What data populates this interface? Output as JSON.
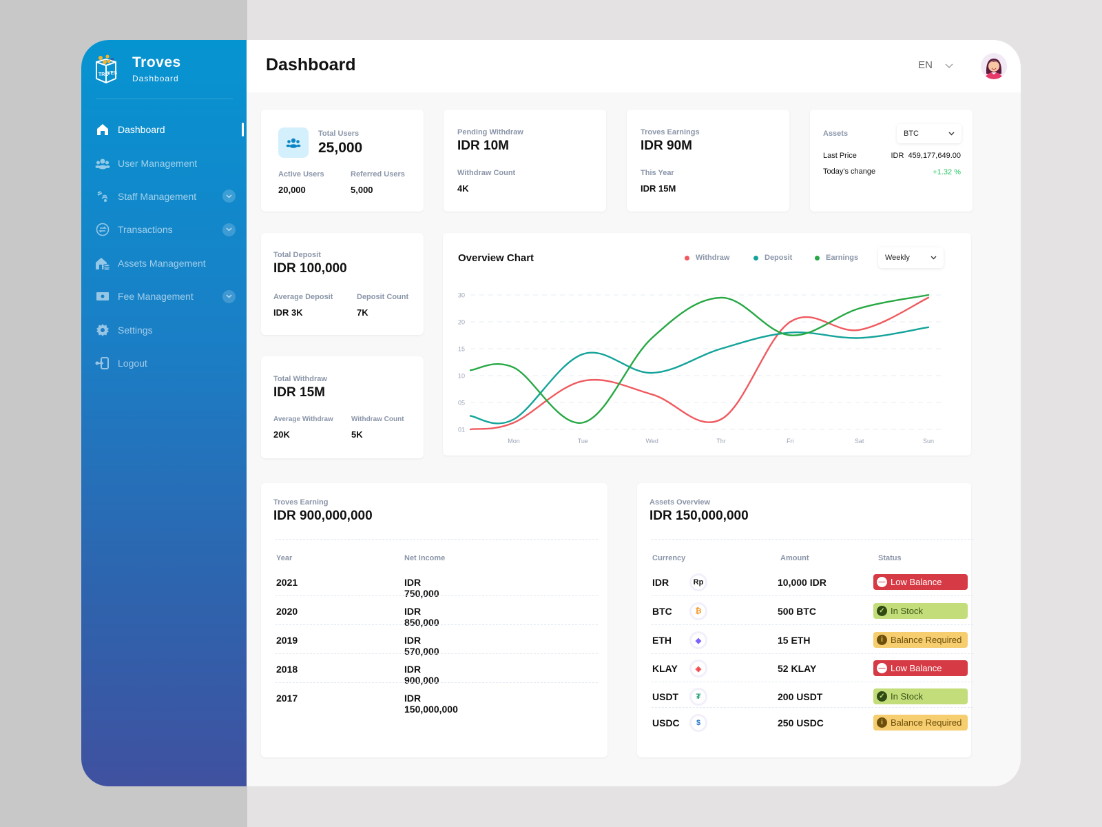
{
  "brand": {
    "title": "Troves",
    "subtitle": "Dashboard"
  },
  "sidebar": {
    "items": [
      {
        "label": "Dashboard",
        "icon": "home-icon",
        "active": true,
        "expandable": false
      },
      {
        "label": "User Management",
        "icon": "users-icon",
        "active": false,
        "expandable": false
      },
      {
        "label": "Staff Management",
        "icon": "staff-icon",
        "active": false,
        "expandable": true
      },
      {
        "label": "Transactions",
        "icon": "transactions-icon",
        "active": false,
        "expandable": true
      },
      {
        "label": "Assets Management",
        "icon": "assets-icon",
        "active": false,
        "expandable": false
      },
      {
        "label": "Fee Management",
        "icon": "fee-icon",
        "active": false,
        "expandable": true
      },
      {
        "label": "Settings",
        "icon": "gear-icon",
        "active": false,
        "expandable": false
      },
      {
        "label": "Logout",
        "icon": "logout-icon",
        "active": false,
        "expandable": false
      }
    ]
  },
  "header": {
    "title": "Dashboard",
    "language": "EN"
  },
  "cards": {
    "users": {
      "label": "Total Users",
      "value": "25,000",
      "active_label": "Active Users",
      "active_value": "20,000",
      "referred_label": "Referred Users",
      "referred_value": "5,000"
    },
    "pending": {
      "label": "Pending Withdraw",
      "value": "IDR 10M",
      "count_label": "Withdraw Count",
      "count_value": "4K"
    },
    "earnings": {
      "label": "Troves Earnings",
      "value": "IDR 90M",
      "year_label": "This Year",
      "year_value": "IDR 15M"
    },
    "assets": {
      "label": "Assets",
      "selected": "BTC",
      "price_label": "Last Price",
      "price_currency": "IDR",
      "price_value": "459,177,649.00",
      "change_label": "Today's change",
      "change_value": "+1.32 %"
    },
    "deposit": {
      "label": "Total Deposit",
      "value": "IDR 100,000",
      "avg_label": "Average Deposit",
      "avg_value": "IDR 3K",
      "count_label": "Deposit Count",
      "count_value": "7K"
    },
    "withdraw": {
      "label": "Total Withdraw",
      "value": "IDR 15M",
      "avg_label": "Average Withdraw",
      "avg_value": "20K",
      "count_label": "Withdraw Count",
      "count_value": "5K"
    }
  },
  "overview": {
    "title": "Overview Chart",
    "period": "Weekly"
  },
  "chart_data": {
    "type": "line",
    "title": "Overview Chart",
    "xlabel": "",
    "ylabel": "",
    "categories": [
      "Mon",
      "Tue",
      "Wed",
      "Thr",
      "Fri",
      "Sat",
      "Sun"
    ],
    "y_ticks": [
      "01",
      "05",
      "10",
      "15",
      "20",
      "30"
    ],
    "grid": true,
    "legend_position": "top-right",
    "note": "Y axis ticks are evenly spaced bands; values expressed in tick units",
    "series": [
      {
        "name": "Withdraw",
        "color": "#ef5a5f",
        "values": [
          2,
          9,
          6.5,
          2.5,
          20,
          18.5,
          29
        ]
      },
      {
        "name": "Deposit",
        "color": "#14a39a",
        "values": [
          2.5,
          14,
          10.5,
          15,
          18,
          17,
          19
        ]
      },
      {
        "name": "Earnings",
        "color": "#27a844",
        "values": [
          11.5,
          2,
          17,
          29,
          17.5,
          25,
          30
        ]
      }
    ]
  },
  "earning_table": {
    "label": "Troves Earning",
    "total": "IDR 900,000,000",
    "headers": [
      "Year",
      "Net Income"
    ],
    "rows": [
      [
        "2021",
        "IDR 750,000"
      ],
      [
        "2020",
        "IDR 850,000"
      ],
      [
        "2019",
        "IDR 570,000"
      ],
      [
        "2018",
        "IDR 900,000"
      ],
      [
        "2017",
        "IDR 150,000,000"
      ]
    ]
  },
  "assets_table": {
    "label": "Assets Overview",
    "total": "IDR 150,000,000",
    "headers": [
      "Currency",
      "Amount",
      "Status"
    ],
    "rows": [
      {
        "currency": "IDR",
        "icon": "rupiah-icon",
        "glyph": "Rp",
        "amount": "10,000 IDR",
        "status": "Low Balance",
        "status_type": "danger"
      },
      {
        "currency": "BTC",
        "icon": "bitcoin-icon",
        "glyph": "₿",
        "amount": "500 BTC",
        "status": "In Stock",
        "status_type": "success"
      },
      {
        "currency": "ETH",
        "icon": "ethereum-icon",
        "glyph": "◆",
        "amount": "15 ETH",
        "status": "Balance Required",
        "status_type": "warning"
      },
      {
        "currency": "KLAY",
        "icon": "klaytn-icon",
        "glyph": "◈",
        "amount": "52 KLAY",
        "status": "Low Balance",
        "status_type": "danger"
      },
      {
        "currency": "USDT",
        "icon": "tether-icon",
        "glyph": "₮",
        "amount": "200 USDT",
        "status": "In Stock",
        "status_type": "success"
      },
      {
        "currency": "USDC",
        "icon": "usdc-icon",
        "glyph": "$",
        "amount": "250 USDC",
        "status": "Balance Required",
        "status_type": "warning"
      }
    ]
  },
  "colors": {
    "accent": "#0694d1",
    "positive": "#22c55e",
    "danger": "#d63a44",
    "success": "#c2dd7a",
    "warning": "#f6cd6f"
  }
}
